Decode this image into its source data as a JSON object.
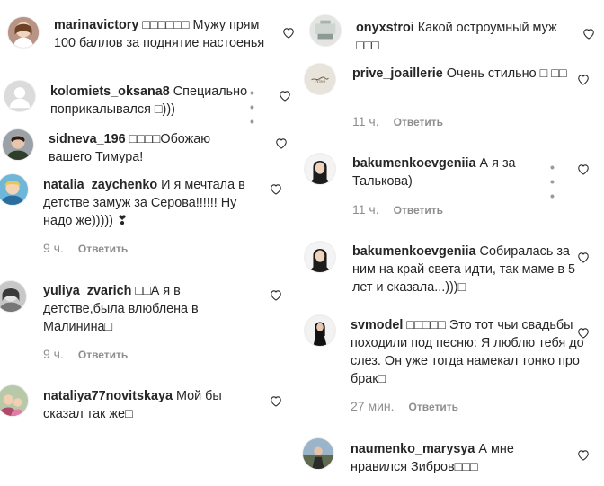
{
  "left": [
    {
      "username": "marinavictory",
      "text": " □□□□□□ Мужу прям 100 баллов за поднятие настоенья",
      "time": "",
      "reply": "",
      "show_dots": false
    },
    {
      "username": "kolomiets_oksana8",
      "text": " Специально поприкалывался □)))",
      "time": "",
      "reply": "",
      "show_dots": true
    },
    {
      "username": "sidneva_196",
      "text": " □□□□Обожаю вашего Тимура!",
      "time": "",
      "reply": "",
      "show_dots": false
    },
    {
      "username": "natalia_zaychenko",
      "text": " И я мечтала в детстве замуж за Серова!!!!!! Ну надо же))))) ❣",
      "time": "9 ч.",
      "reply": "Ответить",
      "show_dots": false
    },
    {
      "username": "yuliya_zvarich",
      "text": " □□А я в детстве,была влюблена в Малинина□",
      "time": "9 ч.",
      "reply": "Ответить",
      "show_dots": false
    },
    {
      "username": "nataliya77novitskaya",
      "text": " Мой бы сказал так же□",
      "time": "",
      "reply": "",
      "show_dots": false
    }
  ],
  "right": [
    {
      "username": "onyxstroi",
      "text": " Какой остроумный муж □□□",
      "time": "",
      "reply": "",
      "show_dots": false
    },
    {
      "username": "prive_joaillerie",
      "text": " Очень стильно □ □□",
      "time": "11 ч.",
      "reply": "Ответить",
      "show_dots": false
    },
    {
      "username": "bakumenkoevgeniia",
      "text": " А я за Талькова)",
      "time": "11 ч.",
      "reply": "Ответить",
      "show_dots": true
    },
    {
      "username": "bakumenkoevgeniia",
      "text": " Собиралась за ним на край света идти, так маме в 5 лет и сказала...)))□",
      "time": "",
      "reply": "",
      "show_dots": false
    },
    {
      "username": "svmodel",
      "text": " □□□□□ Это тот чьи свадьбы походили под песню: Я люблю тебя до слез. Он уже тогда намекал тонко про брак□",
      "time": "27 мин.",
      "reply": "Ответить",
      "show_dots": false
    },
    {
      "username": "naumenko_marysya",
      "text": " А мне нравился Зибров□□□",
      "time": "",
      "reply": "",
      "show_dots": false
    }
  ],
  "icons": {
    "heart": "heart-outline-icon",
    "more": "more-dots-icon",
    "avatar": "avatar"
  },
  "colors": {
    "text": "#262626",
    "secondary": "#8e8e8e",
    "heart_stroke": "#8e8e8e"
  }
}
